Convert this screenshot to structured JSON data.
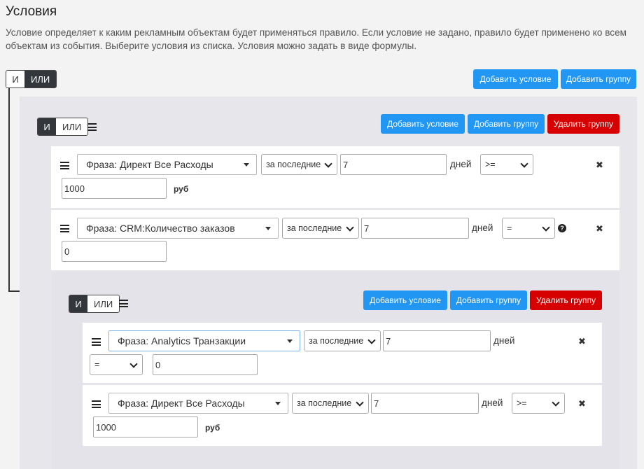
{
  "title": "Условия",
  "description": "Условие определяет к каким рекламным объектам будет применяться правило. Если условие не задано, правило будет применено ко всем объектам из события. Выберите условия из списка. Условия можно задать в виде формулы.",
  "labels": {
    "and": "И",
    "or": "ИЛИ",
    "add_condition": "Добавить условие",
    "add_group": "Добавить группу",
    "delete_group": "Удалить группу",
    "days": "дней",
    "remove": "✖"
  },
  "conditions": [
    {
      "phrase": "Фраза: Директ Все Расходы",
      "period": "за последние",
      "days": "7",
      "operator": ">=",
      "value": "1000",
      "unit": "руб"
    },
    {
      "phrase": "Фраза: CRM:Количество заказов",
      "period": "за последние",
      "days": "7",
      "operator": "=",
      "value": "0",
      "unit": ""
    },
    {
      "phrase": "Фраза: Analytics Транзакции",
      "period": "за последние",
      "days": "7",
      "operator": "=",
      "value": "0",
      "unit": ""
    },
    {
      "phrase": "Фраза: Директ Все Расходы",
      "period": "за последние",
      "days": "7",
      "operator": ">=",
      "value": "1000",
      "unit": "руб"
    }
  ]
}
